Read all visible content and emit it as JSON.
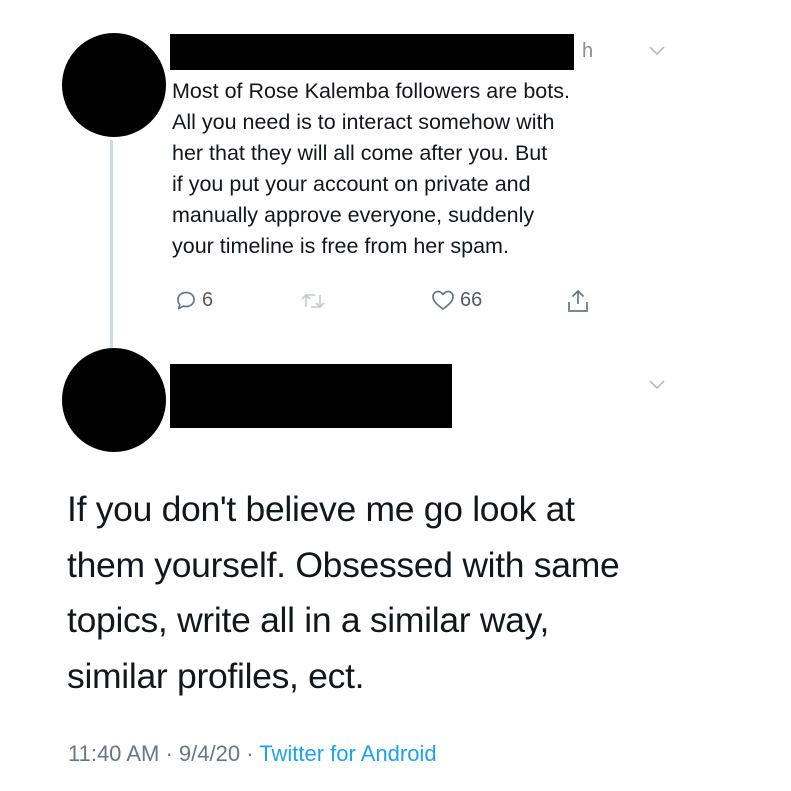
{
  "tweet1": {
    "header_fragment": "h",
    "text": "Most of Rose Kalemba followers are bots.\nAll you need is to interact somehow with\nher that they will all come after you. But\nif you put  your account on private and\nmanually approve everyone, suddenly\nyour timeline is free from her spam.",
    "actions": {
      "reply_icon": "reply-icon",
      "reply_count": "6",
      "retweet_icon": "retweet-icon",
      "like_icon": "heart-icon",
      "like_count": "66",
      "share_icon": "share-icon"
    }
  },
  "tweet2": {
    "text": "If you don't believe me go look at\nthem yourself. Obsessed with same\ntopics, write all in a similar way,\nsimilar profiles, ect.",
    "time": "11:40 AM",
    "separator": "·",
    "date": "9/4/20",
    "source": "Twitter for Android"
  },
  "colors": {
    "text": "#14171a",
    "muted": "#657786",
    "link": "#1da1f2",
    "icon": "#657786",
    "thread_line": "#cfd9de",
    "redaction": "#000000"
  }
}
